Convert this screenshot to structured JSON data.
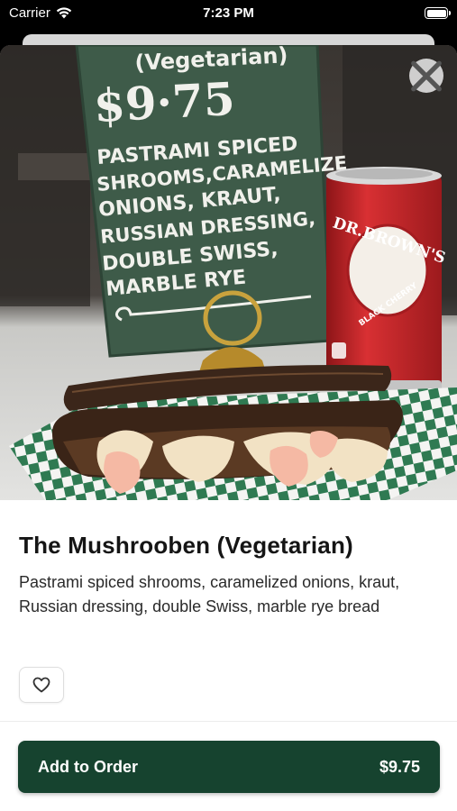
{
  "status_bar": {
    "carrier": "Carrier",
    "time": "7:23 PM"
  },
  "hero": {
    "board_lines": [
      "(Vegetarian)",
      "$9·75",
      "PASTRAMI SPICED",
      "SHROOMS,CARAMELIZE",
      "ONIONS, KRAUT,",
      "RUSSIAN DRESSING,",
      "DOUBLE SWISS,",
      "MARBLE RYE"
    ],
    "can_brand": "DR.BROWN'S",
    "can_flavor": "BLACK CHERRY"
  },
  "item": {
    "title": "The Mushrooben (Vegetarian)",
    "description": "Pastrami spiced shrooms, caramelized onions, kraut, Russian dressing, double Swiss, marble rye bread"
  },
  "actions": {
    "add_label": "Add to Order",
    "price": "$9.75"
  },
  "colors": {
    "accent": "#16432f",
    "board": "#3c5a48",
    "can_red": "#c8262b"
  }
}
